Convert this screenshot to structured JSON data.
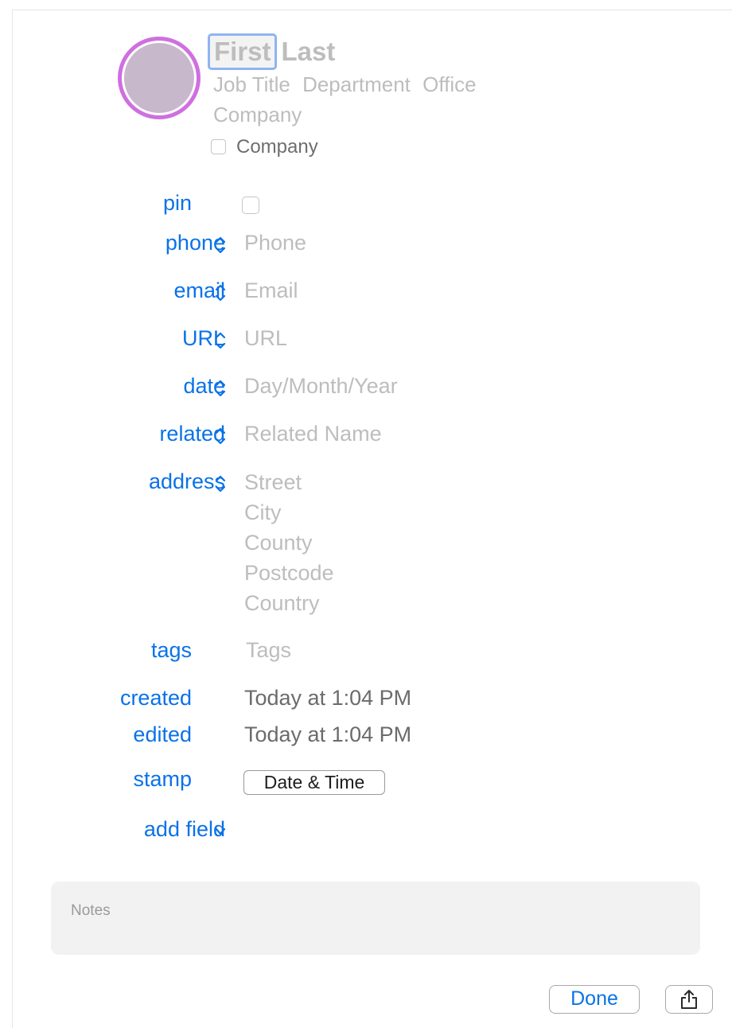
{
  "header": {
    "first_name": "First",
    "last_name": "Last",
    "job_title": "Job Title",
    "department": "Department",
    "office": "Office",
    "company": "Company",
    "company_checkbox_label": "Company"
  },
  "fields": {
    "pin_label": "pin",
    "phone_label": "phone",
    "phone_placeholder": "Phone",
    "email_label": "email",
    "email_placeholder": "Email",
    "url_label": "URL",
    "url_placeholder": "URL",
    "date_label": "date",
    "date_placeholder": "Day/Month/Year",
    "related_label": "related",
    "related_placeholder": "Related Name",
    "address_label": "address",
    "address_lines": [
      "Street",
      "City",
      "County",
      "Postcode",
      "Country"
    ],
    "tags_label": "tags",
    "tags_placeholder": "Tags",
    "created_label": "created",
    "created_value": "Today at 1:04 PM",
    "edited_label": "edited",
    "edited_value": "Today at 1:04 PM",
    "stamp_label": "stamp",
    "stamp_button": "Date & Time",
    "add_field_label": "add field"
  },
  "notes": {
    "placeholder": "Notes"
  },
  "footer": {
    "done_label": "Done"
  },
  "icons": {
    "chevron": "up-down-chevron-icon",
    "add_field": "chevron-down-icon",
    "share": "share-icon"
  },
  "colors": {
    "accent": "#0a72e8",
    "avatar_ring": "#cf6fe0",
    "avatar_fill": "#c8b8cc",
    "focus_ring": "#8fb4f0"
  }
}
